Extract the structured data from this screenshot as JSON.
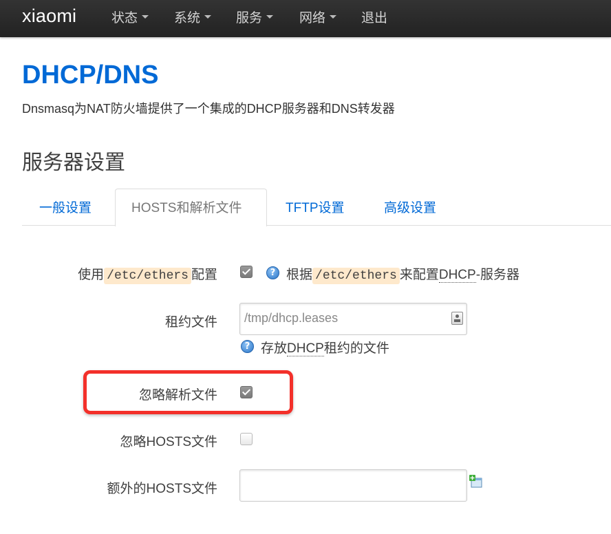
{
  "navbar": {
    "brand": "xiaomi",
    "items": [
      {
        "label": "状态",
        "has_dropdown": true
      },
      {
        "label": "系统",
        "has_dropdown": true
      },
      {
        "label": "服务",
        "has_dropdown": true
      },
      {
        "label": "网络",
        "has_dropdown": true
      },
      {
        "label": "退出",
        "has_dropdown": false
      }
    ]
  },
  "page": {
    "title": "DHCP/DNS",
    "description": "Dnsmasq为NAT防火墙提供了一个集成的DHCP服务器和DNS转发器",
    "section_title": "服务器设置"
  },
  "tabs": [
    {
      "label": "一般设置",
      "active": false
    },
    {
      "label": "HOSTS和解析文件",
      "active": true
    },
    {
      "label": "TFTP设置",
      "active": false
    },
    {
      "label": "高级设置",
      "active": false
    }
  ],
  "form": {
    "use_ethers": {
      "label_prefix": "使用",
      "label_code": "/etc/ethers",
      "label_suffix": "配置",
      "checked": true,
      "help_prefix": "根据",
      "help_code": "/etc/ethers",
      "help_middle": "来配置",
      "help_link": "DHCP",
      "help_suffix": "-服务器"
    },
    "lease_file": {
      "label": "租约文件",
      "placeholder": "/tmp/dhcp.leases",
      "value": "",
      "help_prefix": "存放",
      "help_link": "DHCP",
      "help_suffix": "租约的文件"
    },
    "ignore_resolv": {
      "label": "忽略解析文件",
      "checked": true
    },
    "ignore_hosts": {
      "label": "忽略HOSTS文件",
      "checked": false
    },
    "extra_hosts": {
      "label": "额外的HOSTS文件",
      "value": ""
    }
  },
  "icons": {
    "help": "help-icon",
    "add": "add-icon",
    "input_browse": "browse-icon"
  },
  "colors": {
    "accent": "#0069d6",
    "highlight": "#f3302a",
    "code_bg": "#fee9cc",
    "navbar_bg": "#222222"
  }
}
